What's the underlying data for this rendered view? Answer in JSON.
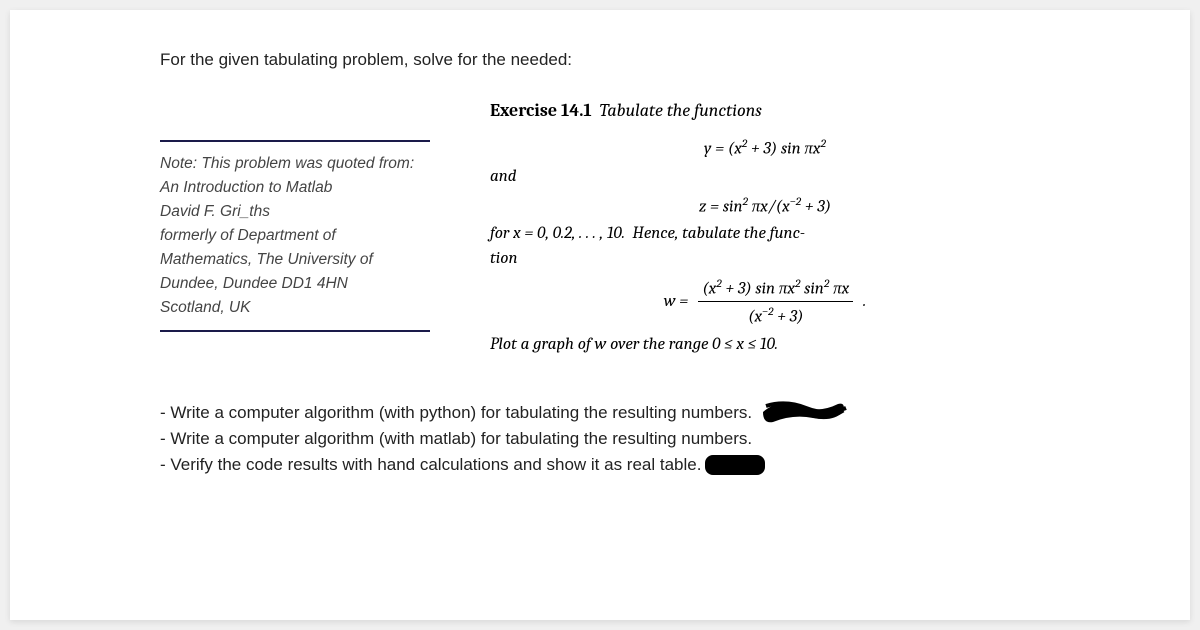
{
  "intro": "For the given tabulating problem, solve for the needed:",
  "note": {
    "line1": "Note: This problem was quoted from:",
    "line2": "An Introduction to Matlab",
    "line3": "David F. Gri_ths",
    "line4": "formerly of Department of",
    "line5": "Mathematics, The University of",
    "line6": "Dundee, Dundee DD1 4HN",
    "line7": "Scotland, UK"
  },
  "exercise": {
    "label": "Exercise 14.1",
    "subtitle": "Tabulate the functions",
    "eq_y": "y = (x² + 3) sin πx²",
    "and_word": "and",
    "eq_z": "z = sin² πx/(x⁻² + 3)",
    "for_x": "for x = 0, 0.2, . . . , 10.  Hence, tabulate the func-",
    "tion_word": "tion",
    "w_prefix": "w =",
    "w_num": "(x² + 3) sin πx² sin² πx",
    "w_den": "(x⁻² + 3)",
    "w_dot": ".",
    "plot_line": "Plot a graph of w over the range 0 ≤ x ≤ 10."
  },
  "tasks": {
    "t1": "- Write a computer algorithm (with python) for tabulating the resulting numbers.",
    "t2": "- Write a computer algorithm (with matlab) for tabulating the resulting numbers.",
    "t3": "- Verify the code results with hand calculations and show it as real table."
  }
}
